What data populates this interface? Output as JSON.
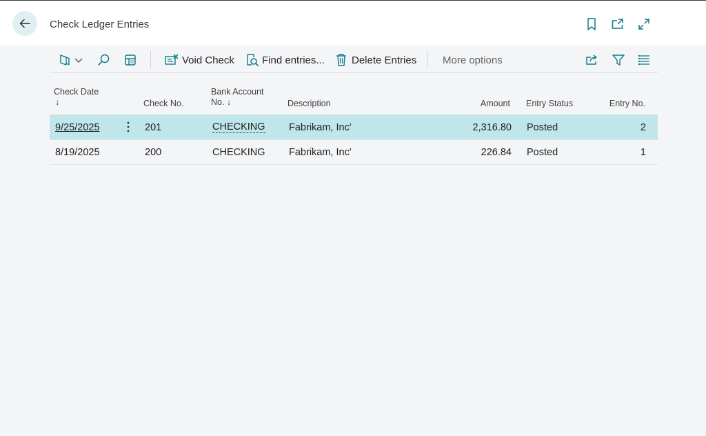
{
  "header": {
    "title": "Check Ledger Entries"
  },
  "toolbar": {
    "void_check": "Void Check",
    "find_entries": "Find entries...",
    "delete_entries": "Delete Entries",
    "more_options": "More options"
  },
  "table": {
    "columns": {
      "check_date_line1": "Check Date",
      "check_date_arrow": "↓",
      "check_no": "Check No.",
      "bank_account_line1": "Bank Account",
      "bank_account_line2": "No. ↓",
      "description": "Description",
      "amount": "Amount",
      "entry_status": "Entry Status",
      "entry_no": "Entry No."
    },
    "rows": [
      {
        "check_date": "9/25/2025",
        "check_no": "201",
        "bank_account": "CHECKING",
        "description": "Fabrikam, Inc'",
        "amount": "2,316.80",
        "entry_status": "Posted",
        "entry_no": "2",
        "selected": true
      },
      {
        "check_date": "8/19/2025",
        "check_no": "200",
        "bank_account": "CHECKING",
        "description": "Fabrikam, Inc'",
        "amount": "226.84",
        "entry_status": "Posted",
        "entry_no": "1",
        "selected": false
      }
    ]
  },
  "colors": {
    "accent": "#0f7c8c",
    "selected_row": "#bfe6eb",
    "back_button_bg": "#dfeff2"
  },
  "icons": {
    "back": "arrow-left-icon",
    "bookmark": "bookmark-icon",
    "open_new": "open-in-new-window-icon",
    "expand": "expand-icon",
    "dynamics": "dynamics-logo-icon",
    "search": "search-icon",
    "layout": "layout-icon",
    "void": "void-check-icon",
    "find": "find-entries-icon",
    "delete": "trash-icon",
    "share": "share-icon",
    "filter": "filter-icon",
    "list": "list-view-icon"
  }
}
